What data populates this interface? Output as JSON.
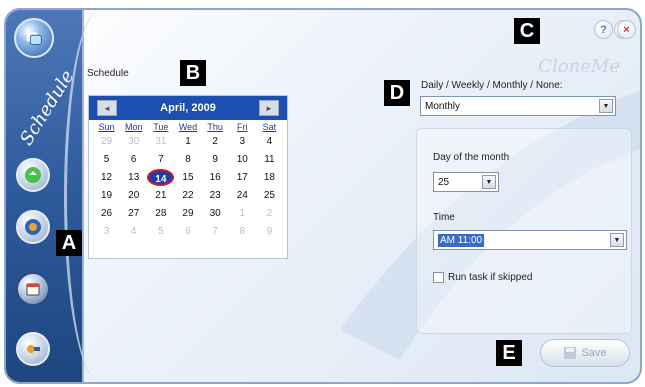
{
  "window": {
    "sidebar_title": "Schedule",
    "watermark": "CloneMe"
  },
  "controls": {
    "help_icon": "?",
    "minimize_icon": "–",
    "close_icon": "×"
  },
  "callouts": {
    "a": "A",
    "b": "B",
    "c": "C",
    "d": "D",
    "e": "E"
  },
  "schedule": {
    "section_label": "Schedule",
    "calendar": {
      "month": "April, 2009",
      "prev": "◄",
      "next": "►",
      "days_of_week": [
        "Sun",
        "Mon",
        "Tue",
        "Wed",
        "Thu",
        "Fri",
        "Sat"
      ],
      "weeks": [
        [
          "29",
          "30",
          "31",
          "1",
          "2",
          "3",
          "4"
        ],
        [
          "5",
          "6",
          "7",
          "8",
          "9",
          "10",
          "11"
        ],
        [
          "12",
          "13",
          "14",
          "15",
          "16",
          "17",
          "18"
        ],
        [
          "19",
          "20",
          "21",
          "22",
          "23",
          "24",
          "25"
        ],
        [
          "26",
          "27",
          "28",
          "29",
          "30",
          "1",
          "2"
        ],
        [
          "3",
          "4",
          "5",
          "6",
          "7",
          "8",
          "9"
        ]
      ],
      "selected_day": "14"
    }
  },
  "settings": {
    "frequency_label": "Daily / Weekly / Monthly / None:",
    "frequency_value": "Monthly",
    "day_of_month_label": "Day of the month",
    "day_of_month_value": "25",
    "time_label": "Time",
    "time_value": "AM 11:00",
    "run_if_skipped_label": "Run task if skipped",
    "run_if_skipped_checked": false
  },
  "actions": {
    "save_label": "Save"
  },
  "colors": {
    "sidebar": "#2d5a9c",
    "calendar_header": "#1c4fb0",
    "selected_day_ring": "#d0182a"
  }
}
